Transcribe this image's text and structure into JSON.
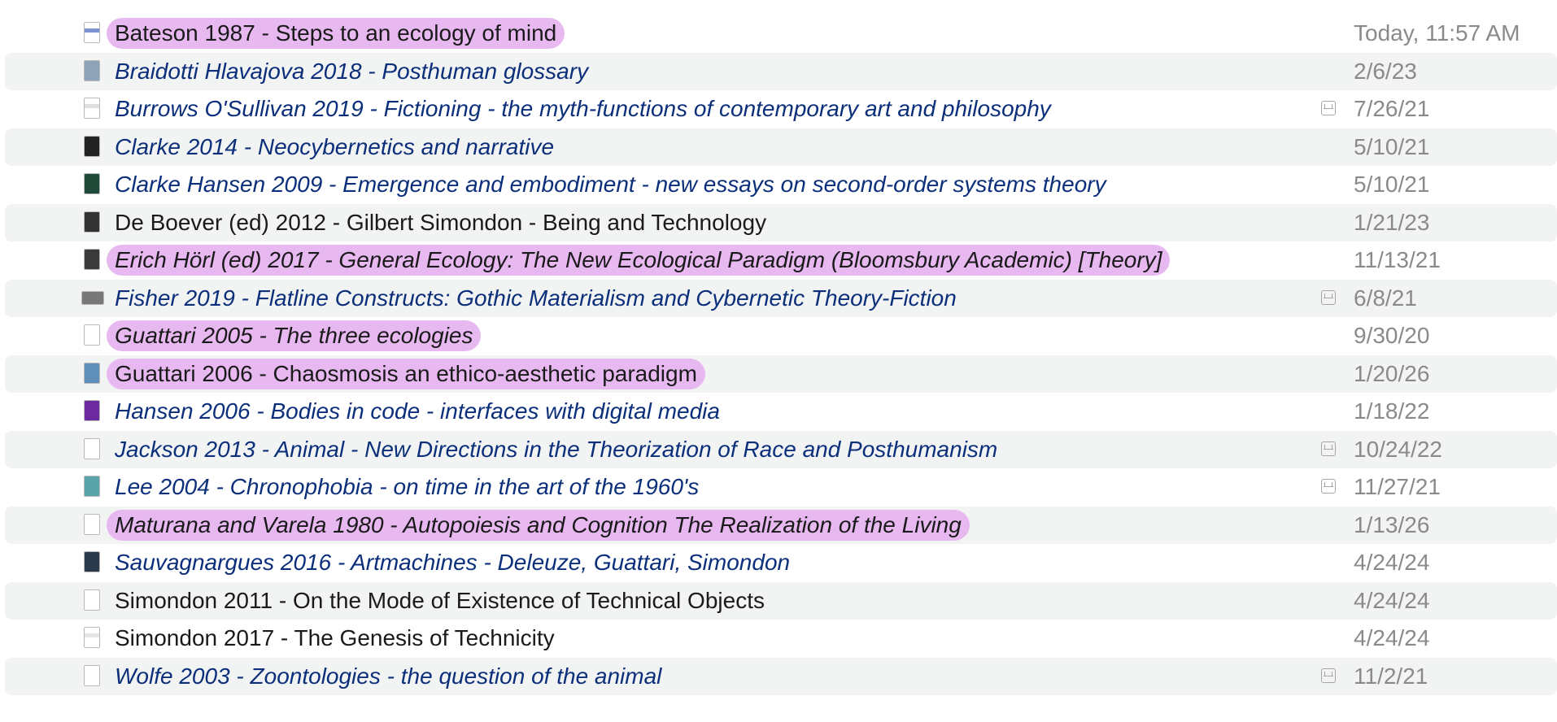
{
  "files": [
    {
      "name": "Bateson 1987 - Steps to an ecology of mind",
      "date": "Today, 11:57 AM",
      "style": "plain",
      "highlight": true,
      "cloud": false,
      "thumb": "page-icon",
      "thumb_color": "#5a78c8"
    },
    {
      "name": "Braidotti Hlavajova 2018 - Posthuman glossary",
      "date": "2/6/23",
      "style": "link",
      "highlight": false,
      "cloud": false,
      "thumb": "cover-icon",
      "thumb_color": "#8fa3b8"
    },
    {
      "name": "Burrows O'Sullivan 2019 - Fictioning - the myth-functions of contemporary art and philosophy",
      "date": "7/26/21",
      "style": "link",
      "highlight": false,
      "cloud": true,
      "thumb": "page-icon",
      "thumb_color": "#d8d8d8"
    },
    {
      "name": "Clarke 2014 - Neocybernetics and narrative",
      "date": "5/10/21",
      "style": "link",
      "highlight": false,
      "cloud": false,
      "thumb": "cover-icon",
      "thumb_color": "#222222"
    },
    {
      "name": "Clarke Hansen 2009 - Emergence and embodiment - new essays on second-order systems theory",
      "date": "5/10/21",
      "style": "link",
      "highlight": false,
      "cloud": false,
      "thumb": "cover-icon",
      "thumb_color": "#1f4a3a"
    },
    {
      "name": "De Boever (ed) 2012 - Gilbert Simondon - Being and Technology",
      "date": "1/21/23",
      "style": "plain",
      "highlight": false,
      "cloud": false,
      "thumb": "cover-icon",
      "thumb_color": "#333333"
    },
    {
      "name": "Erich Hörl (ed) 2017 - General Ecology: The New Ecological Paradigm (Bloomsbury Academic) [Theory]",
      "date": "11/13/21",
      "style": "link",
      "highlight": true,
      "cloud": false,
      "thumb": "cover-icon",
      "thumb_color": "#3a3a3a"
    },
    {
      "name": "Fisher 2019 - Flatline Constructs: Gothic Materialism and Cybernetic Theory-Fiction",
      "date": "6/8/21",
      "style": "link",
      "highlight": false,
      "cloud": true,
      "thumb": "wide-icon",
      "thumb_color": "#777777"
    },
    {
      "name": "Guattari 2005 - The three ecologies",
      "date": "9/30/20",
      "style": "link",
      "highlight": true,
      "cloud": false,
      "thumb": "page-icon",
      "thumb_color": "#ffffff"
    },
    {
      "name": "Guattari 2006 - Chaosmosis an ethico-aesthetic paradigm",
      "date": "1/20/26",
      "style": "plain",
      "highlight": true,
      "cloud": false,
      "thumb": "cover-icon",
      "thumb_color": "#5f8fb8"
    },
    {
      "name": "Hansen 2006 - Bodies in code - interfaces with digital media",
      "date": "1/18/22",
      "style": "link",
      "highlight": false,
      "cloud": false,
      "thumb": "cover-icon",
      "thumb_color": "#6b2aa0"
    },
    {
      "name": "Jackson 2013 - Animal - New Directions in the Theorization of Race and Posthumanism",
      "date": "10/24/22",
      "style": "link",
      "highlight": false,
      "cloud": true,
      "thumb": "page-icon",
      "thumb_color": "#ffffff"
    },
    {
      "name": "Lee 2004 - Chronophobia - on time in the art of the 1960's",
      "date": "11/27/21",
      "style": "link",
      "highlight": false,
      "cloud": true,
      "thumb": "cover-icon",
      "thumb_color": "#5aa3a8"
    },
    {
      "name": "Maturana and Varela 1980 - Autopoiesis and Cognition The Realization of the Living",
      "date": "1/13/26",
      "style": "link",
      "highlight": true,
      "cloud": false,
      "thumb": "page-icon",
      "thumb_color": "#ffffff"
    },
    {
      "name": "Sauvagnargues 2016 - Artmachines - Deleuze, Guattari, Simondon",
      "date": "4/24/24",
      "style": "link",
      "highlight": false,
      "cloud": false,
      "thumb": "cover-icon",
      "thumb_color": "#2a3a4a"
    },
    {
      "name": "Simondon 2011 - On the Mode of Existence of Technical Objects",
      "date": "4/24/24",
      "style": "plain",
      "highlight": false,
      "cloud": false,
      "thumb": "page-icon",
      "thumb_color": "#ffffff"
    },
    {
      "name": "Simondon 2017 - The Genesis of Technicity",
      "date": "4/24/24",
      "style": "plain",
      "highlight": false,
      "cloud": false,
      "thumb": "page-icon",
      "thumb_color": "#e0e0e0"
    },
    {
      "name": "Wolfe 2003 - Zoontologies - the question of the animal",
      "date": "11/2/21",
      "style": "link",
      "highlight": false,
      "cloud": true,
      "thumb": "page-icon",
      "thumb_color": "#ffffff"
    }
  ],
  "colors": {
    "highlight": "#e8b9f1",
    "link_text": "#0b2f7a",
    "date_text": "#8a8a8a",
    "alt_row": "#f2f3f3"
  }
}
